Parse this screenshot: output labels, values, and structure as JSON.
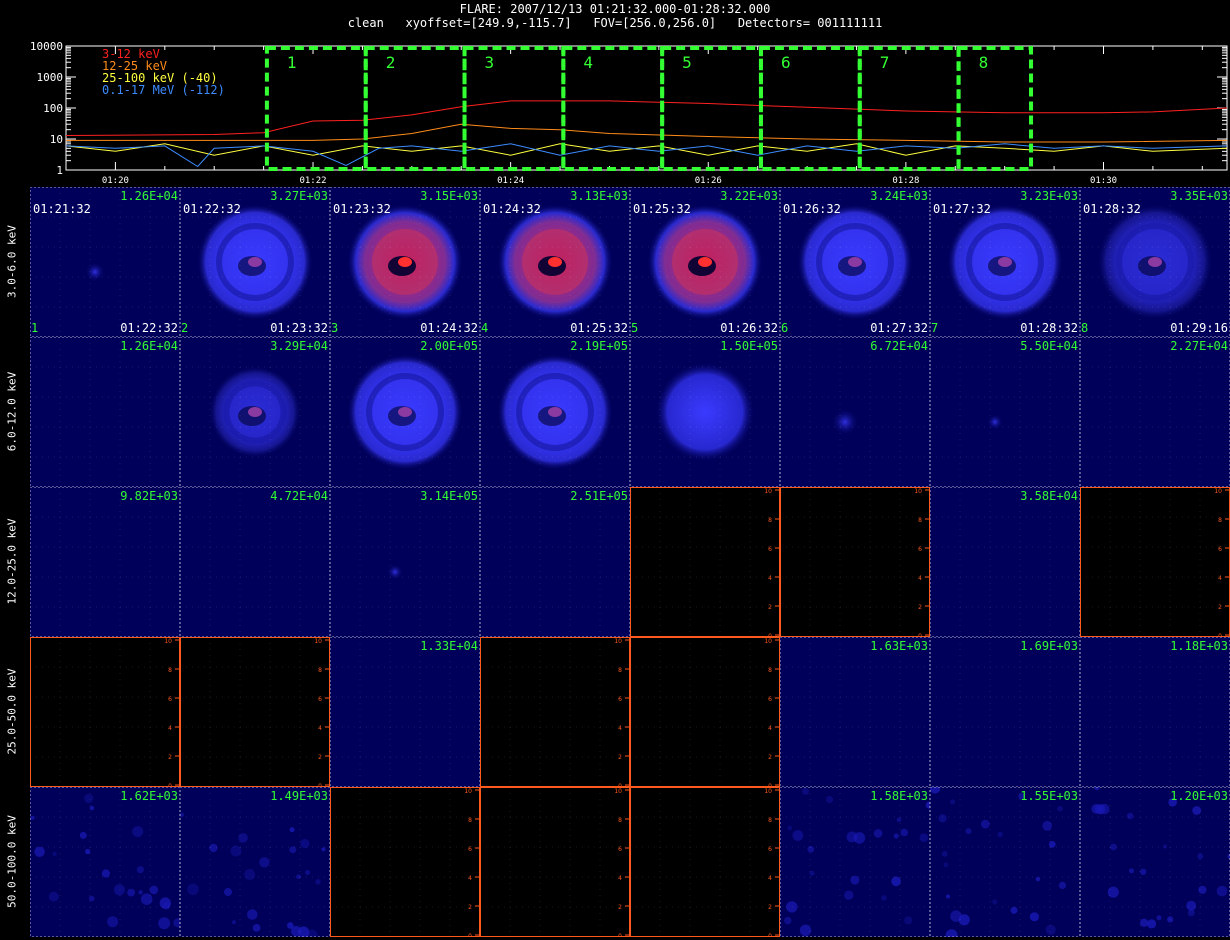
{
  "title": {
    "line1": "FLARE: 2007/12/13 01:21:32.000-01:28:32.000",
    "line2": "clean   xyoffset=[249.9,-115.7]   FOV=[256.0,256.0]   Detectors= 001111111"
  },
  "chart_data": [
    {
      "type": "line",
      "yscale": "log",
      "ylim": [
        1,
        10000
      ],
      "yticks": [
        "10000",
        "1000",
        "100",
        "10",
        "1"
      ],
      "xlim": [
        "01:19:30",
        "01:31:15"
      ],
      "xticks": [
        "01:20",
        "01:22",
        "01:24",
        "01:26",
        "01:28",
        "01:30"
      ],
      "legend_placement": "top-left",
      "series": [
        {
          "name": "3-12 keV",
          "color": "#ff2020",
          "x": [
            "01:19:30",
            "01:21:00",
            "01:21:30",
            "01:22:00",
            "01:22:30",
            "01:23:00",
            "01:23:30",
            "01:24:00",
            "01:25:00",
            "01:26:00",
            "01:27:00",
            "01:28:00",
            "01:29:00",
            "01:30:00",
            "01:30:30",
            "01:31:15"
          ],
          "y": [
            13,
            14,
            16,
            38,
            40,
            60,
            110,
            170,
            170,
            140,
            105,
            80,
            70,
            70,
            75,
            100
          ]
        },
        {
          "name": "12-25 keV",
          "color": "#ff8c1a",
          "x": [
            "01:19:30",
            "01:21:00",
            "01:22:00",
            "01:22:30",
            "01:23:00",
            "01:23:30",
            "01:24:00",
            "01:24:30",
            "01:25:00",
            "01:26:00",
            "01:27:00",
            "01:28:00",
            "01:29:00",
            "01:30:00",
            "01:31:15"
          ],
          "y": [
            9,
            9,
            9,
            10,
            15,
            30,
            22,
            20,
            15,
            12,
            10,
            9,
            8,
            8,
            9
          ]
        },
        {
          "name": "25-100 keV (-40)",
          "color": "#ffff40",
          "x": [
            "01:19:30",
            "01:20:00",
            "01:20:30",
            "01:21:00",
            "01:21:30",
            "01:22:00",
            "01:22:30",
            "01:23:00",
            "01:23:30",
            "01:24:00",
            "01:24:30",
            "01:25:00",
            "01:25:30",
            "01:26:00",
            "01:26:30",
            "01:27:00",
            "01:27:30",
            "01:28:00",
            "01:28:30",
            "01:29:00",
            "01:29:30",
            "01:30:00",
            "01:30:30",
            "01:31:15"
          ],
          "y": [
            6,
            4,
            7,
            3,
            6,
            3,
            6,
            4,
            6,
            3,
            7,
            4,
            6,
            3,
            6,
            4,
            7,
            3,
            6,
            5,
            4,
            6,
            4,
            5
          ]
        },
        {
          "name": "0.1-17 MeV (-112)",
          "color": "#3c8cff",
          "x": [
            "01:19:30",
            "01:20:00",
            "01:20:30",
            "01:20:50",
            "01:21:00",
            "01:21:30",
            "01:22:00",
            "01:22:20",
            "01:22:40",
            "01:23:00",
            "01:23:30",
            "01:24:00",
            "01:24:30",
            "01:25:00",
            "01:25:30",
            "01:26:00",
            "01:26:30",
            "01:27:00",
            "01:27:30",
            "01:28:00",
            "01:28:30",
            "01:29:00",
            "01:29:30",
            "01:30:00",
            "01:30:30",
            "01:31:15"
          ],
          "y": [
            6,
            5,
            6,
            1.3,
            5,
            6,
            4,
            1.4,
            5,
            6,
            4,
            7,
            3,
            6,
            4,
            6,
            3,
            6,
            4,
            6,
            5,
            7,
            5,
            6,
            5,
            6
          ]
        }
      ],
      "intervals": [
        {
          "label": "1",
          "start": "01:21:32",
          "end": "01:22:32"
        },
        {
          "label": "2",
          "start": "01:22:32",
          "end": "01:23:32"
        },
        {
          "label": "3",
          "start": "01:23:32",
          "end": "01:24:32"
        },
        {
          "label": "4",
          "start": "01:24:32",
          "end": "01:25:32"
        },
        {
          "label": "5",
          "start": "01:25:32",
          "end": "01:26:32"
        },
        {
          "label": "6",
          "start": "01:26:32",
          "end": "01:27:32"
        },
        {
          "label": "7",
          "start": "01:27:32",
          "end": "01:28:32"
        },
        {
          "label": "8",
          "start": "01:28:32",
          "end": "01:29:16"
        }
      ]
    },
    {
      "type": "heatmap",
      "columns": [
        {
          "index": "1",
          "start": "01:21:32",
          "end": "01:22:32"
        },
        {
          "index": "2",
          "start": "01:22:32",
          "end": "01:23:32"
        },
        {
          "index": "3",
          "start": "01:23:32",
          "end": "01:24:32"
        },
        {
          "index": "4",
          "start": "01:24:32",
          "end": "01:25:32"
        },
        {
          "index": "5",
          "start": "01:25:32",
          "end": "01:26:32"
        },
        {
          "index": "6",
          "start": "01:26:32",
          "end": "01:27:32"
        },
        {
          "index": "7",
          "start": "01:27:32",
          "end": "01:28:32"
        },
        {
          "index": "8",
          "start": "01:28:32",
          "end": "01:29:16"
        }
      ],
      "rows": [
        {
          "energy": "3.0-6.0 keV",
          "peaks": [
            "1.26E+04",
            "3.27E+03",
            "3.15E+03",
            "3.13E+03",
            "3.22E+03",
            "3.24E+03",
            "3.23E+03",
            "3.35E+03"
          ],
          "images": [
            "faint",
            "ring",
            "ring-bright",
            "ring-bright",
            "ring-bright",
            "ring",
            "ring",
            "ring-faint"
          ]
        },
        {
          "energy": "6.0-12.0 keV",
          "peaks": [
            "1.26E+04",
            "3.29E+04",
            "2.00E+05",
            "2.19E+05",
            "1.50E+05",
            "6.72E+04",
            "5.50E+04",
            "2.27E+04"
          ],
          "images": [
            "empty",
            "faint-ring",
            "ring",
            "ring",
            "disk",
            "blob",
            "dot",
            "empty"
          ]
        },
        {
          "energy": "12.0-25.0 keV",
          "peaks": [
            "9.82E+03",
            "4.72E+04",
            "3.14E+05",
            "2.51E+05",
            "",
            "",
            "3.58E+04",
            ""
          ],
          "images": [
            "empty",
            "empty",
            "dot",
            "empty",
            "blank",
            "blank",
            "empty",
            "blank"
          ]
        },
        {
          "energy": "25.0-50.0 keV",
          "peaks": [
            "",
            "",
            "1.33E+04",
            "",
            "",
            "1.63E+03",
            "1.69E+03",
            "1.18E+03"
          ],
          "images": [
            "blank",
            "blank",
            "empty",
            "blank",
            "blank",
            "empty",
            "empty",
            "empty"
          ]
        },
        {
          "energy": "50.0-100.0 keV",
          "peaks": [
            "1.62E+03",
            "1.49E+03",
            "",
            "",
            "",
            "1.58E+03",
            "1.55E+03",
            "1.20E+03"
          ],
          "images": [
            "noise",
            "noise",
            "blank",
            "blank",
            "blank",
            "noise",
            "noise",
            "noise"
          ]
        }
      ],
      "blank_axis_ticks": [
        "0",
        "2",
        "4",
        "6",
        "8",
        "10"
      ]
    }
  ]
}
